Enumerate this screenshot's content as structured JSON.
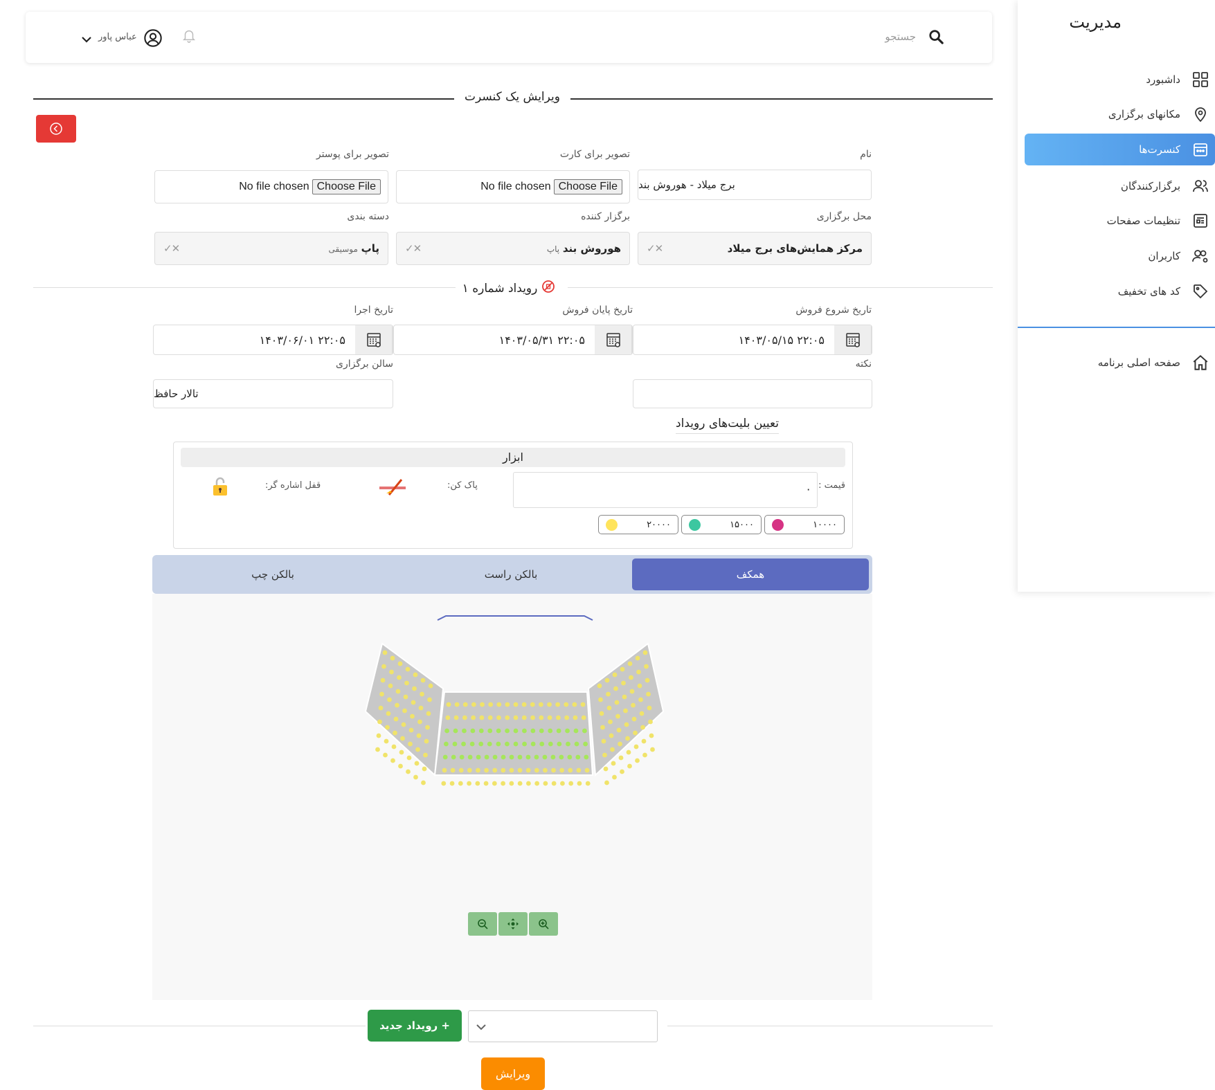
{
  "sidebar": {
    "brand": "مدیریت",
    "items": [
      {
        "label": "داشبورد",
        "icon": "dashboard-icon"
      },
      {
        "label": "مکانهای برگزاری",
        "icon": "location-pin-icon"
      },
      {
        "label": "کنسرت‌ها",
        "icon": "calendar-icon"
      },
      {
        "label": "برگزارکنندگان",
        "icon": "organizers-icon"
      },
      {
        "label": "تنظیمات صفحات",
        "icon": "page-settings-icon"
      },
      {
        "label": "کاربران",
        "icon": "users-gear-icon"
      },
      {
        "label": "کد های تخفیف",
        "icon": "tag-icon"
      }
    ],
    "home": {
      "label": "صفحه اصلی برنامه",
      "icon": "home-icon"
    },
    "active_index": 2,
    "accent": "#4a90e2"
  },
  "header": {
    "search_label": "جستجو",
    "user_name": "عباس پاور"
  },
  "page": {
    "title": "ویرایش یک کنسرت"
  },
  "form": {
    "name_label": "نام",
    "name_value": "برج میلاد - هوروش بند",
    "card_image_label": "تصویر برای کارت",
    "poster_image_label": "تصویر برای پوستر",
    "file_button": "Choose File",
    "file_status": "No file chosen",
    "venue_label": "محل برگزاری",
    "venue_value": "مرکز همایش‌های برج میلاد",
    "organizer_label": "برگزار کننده",
    "organizer_value": "هوروش بند",
    "organizer_sub": "پاپ",
    "category_label": "دسته بندی",
    "category_value": "پاپ",
    "category_sub": "موسیقی",
    "clear_mark": "✕",
    "dropdown_mark": "✓"
  },
  "event": {
    "title": "رویداد شماره ۱",
    "sale_start_label": "تاریخ شروع فروش",
    "sale_start_value": "۲۲:۰۵ ۱۴۰۳/۰۵/۱۵",
    "sale_end_label": "تاریخ پایان فروش",
    "sale_end_value": "۲۲:۰۵ ۱۴۰۳/۰۵/۳۱",
    "perform_label": "تاریخ اجرا",
    "perform_value": "۲۲:۰۵ ۱۴۰۳/۰۶/۰۱",
    "note_label": "نکته",
    "note_value": "",
    "hall_label": "سالن برگزاری",
    "hall_value": "تالار حافظ"
  },
  "tickets": {
    "title": "تعیین بلیت‌های رویداد",
    "tools_title": "ابزار",
    "price_label": "قیمت :",
    "price_value": "۰",
    "eraser_label": "پاک کن:",
    "lock_label": "قفل اشاره گر:",
    "prices": [
      {
        "value": "۱۰۰۰۰",
        "color": "#d63384"
      },
      {
        "value": "۱۵۰۰۰",
        "color": "#3cc7a0"
      },
      {
        "value": "۲۰۰۰۰",
        "color": "#ffe45c"
      }
    ]
  },
  "tabs": {
    "items": [
      "همکف",
      "بالکن راست",
      "بالکن چپ"
    ],
    "active_index": 0
  },
  "bottom": {
    "new_event": "+ رویداد جدید",
    "edit": "ویرایش"
  }
}
